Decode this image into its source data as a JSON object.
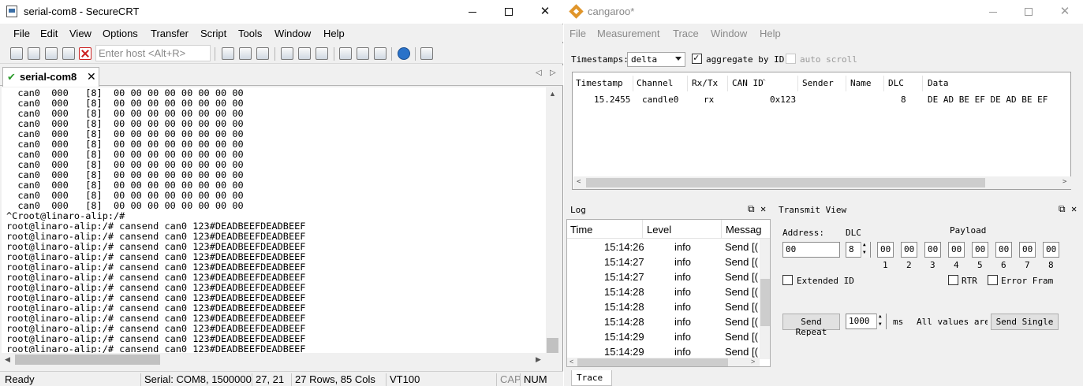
{
  "securecrt": {
    "title": "serial-com8 - SecureCRT",
    "menu": [
      "File",
      "Edit",
      "View",
      "Options",
      "Transfer",
      "Script",
      "Tools",
      "Window",
      "Help"
    ],
    "host_placeholder": "Enter host <Alt+R>",
    "tab_label": "serial-com8",
    "terminal_lines": [
      "  can0  000   [8]  00 00 00 00 00 00 00 00",
      "  can0  000   [8]  00 00 00 00 00 00 00 00",
      "  can0  000   [8]  00 00 00 00 00 00 00 00",
      "  can0  000   [8]  00 00 00 00 00 00 00 00",
      "  can0  000   [8]  00 00 00 00 00 00 00 00",
      "  can0  000   [8]  00 00 00 00 00 00 00 00",
      "  can0  000   [8]  00 00 00 00 00 00 00 00",
      "  can0  000   [8]  00 00 00 00 00 00 00 00",
      "  can0  000   [8]  00 00 00 00 00 00 00 00",
      "  can0  000   [8]  00 00 00 00 00 00 00 00",
      "  can0  000   [8]  00 00 00 00 00 00 00 00",
      "  can0  000   [8]  00 00 00 00 00 00 00 00",
      "^Croot@linaro-alip:/#",
      "root@linaro-alip:/# cansend can0 123#DEADBEEFDEADBEEF",
      "root@linaro-alip:/# cansend can0 123#DEADBEEFDEADBEEF",
      "root@linaro-alip:/# cansend can0 123#DEADBEEFDEADBEEF",
      "root@linaro-alip:/# cansend can0 123#DEADBEEFDEADBEEF",
      "root@linaro-alip:/# cansend can0 123#DEADBEEFDEADBEEF",
      "root@linaro-alip:/# cansend can0 123#DEADBEEFDEADBEEF",
      "root@linaro-alip:/# cansend can0 123#DEADBEEFDEADBEEF",
      "root@linaro-alip:/# cansend can0 123#DEADBEEFDEADBEEF",
      "root@linaro-alip:/# cansend can0 123#DEADBEEFDEADBEEF",
      "root@linaro-alip:/# cansend can0 123#DEADBEEFDEADBEEF",
      "root@linaro-alip:/# cansend can0 123#DEADBEEFDEADBEEF",
      "root@linaro-alip:/# cansend can0 123#DEADBEEFDEADBEEF",
      "root@linaro-alip:/# cansend can0 123#DEADBEEFDEADBEEF"
    ],
    "prompt_line": "root@linaro-alip:/# ",
    "status": {
      "ready": "Ready",
      "serial": "Serial: COM8, 1500000",
      "cursor_pos": "27,  21",
      "size": "27 Rows, 85 Cols",
      "emulation": "VT100",
      "cap": "CAP",
      "num": "NUM"
    }
  },
  "cangaroo": {
    "title": "cangaroo*",
    "menu": [
      "File",
      "Measurement",
      "Trace",
      "Window",
      "Help"
    ],
    "timestamps_label": "Timestamps:",
    "timestamps_value": "delta",
    "aggregate_label": "aggregate by ID",
    "aggregate_checked": true,
    "autoscroll_label": "auto scroll",
    "autoscroll_checked": false,
    "trace": {
      "columns": [
        "Timestamp",
        "Channel",
        "Rx/Tx",
        "CAN ID",
        "Sender",
        "Name",
        "DLC",
        "Data"
      ],
      "rows": [
        {
          "timestamp": "15.2455",
          "channel": "candle0",
          "rxtx": "rx",
          "can_id": "0x123",
          "sender": "",
          "name": "",
          "dlc": "8",
          "data": "DE AD BE EF DE AD BE EF"
        }
      ]
    },
    "log": {
      "title": "Log",
      "columns": [
        "Time",
        "Level",
        "Messag"
      ],
      "rows": [
        {
          "time": "15:14:26",
          "level": "info",
          "message": "Send [("
        },
        {
          "time": "15:14:27",
          "level": "info",
          "message": "Send [("
        },
        {
          "time": "15:14:27",
          "level": "info",
          "message": "Send [("
        },
        {
          "time": "15:14:28",
          "level": "info",
          "message": "Send [("
        },
        {
          "time": "15:14:28",
          "level": "info",
          "message": "Send [("
        },
        {
          "time": "15:14:28",
          "level": "info",
          "message": "Send [("
        },
        {
          "time": "15:14:29",
          "level": "info",
          "message": "Send [("
        },
        {
          "time": "15:14:29",
          "level": "info",
          "message": "Send [("
        }
      ]
    },
    "transmit": {
      "title": "Transmit View",
      "address_label": "Address:",
      "address_value": "00",
      "dlc_label": "DLC",
      "dlc_value": "8",
      "payload_label": "Payload",
      "payload_values": [
        "00",
        "00",
        "00",
        "00",
        "00",
        "00",
        "00",
        "00"
      ],
      "payload_indices": [
        "1",
        "2",
        "3",
        "4",
        "5",
        "6",
        "7",
        "8"
      ],
      "extended_id_label": "Extended ID",
      "rtr_label": "RTR",
      "error_frame_label": "Error Fram",
      "send_repeat_label": "Send Repeat",
      "repeat_value": "1000",
      "ms_label": "ms",
      "all_values_label": "All values are",
      "send_single_label": "Send Single"
    },
    "bottom_tab": "Trace"
  },
  "colors": {
    "window_bg": "#f0f0f0",
    "terminal_bg": "#ffffff",
    "logo": "#e0952a",
    "disabled_menu": "#8a8a8a"
  }
}
